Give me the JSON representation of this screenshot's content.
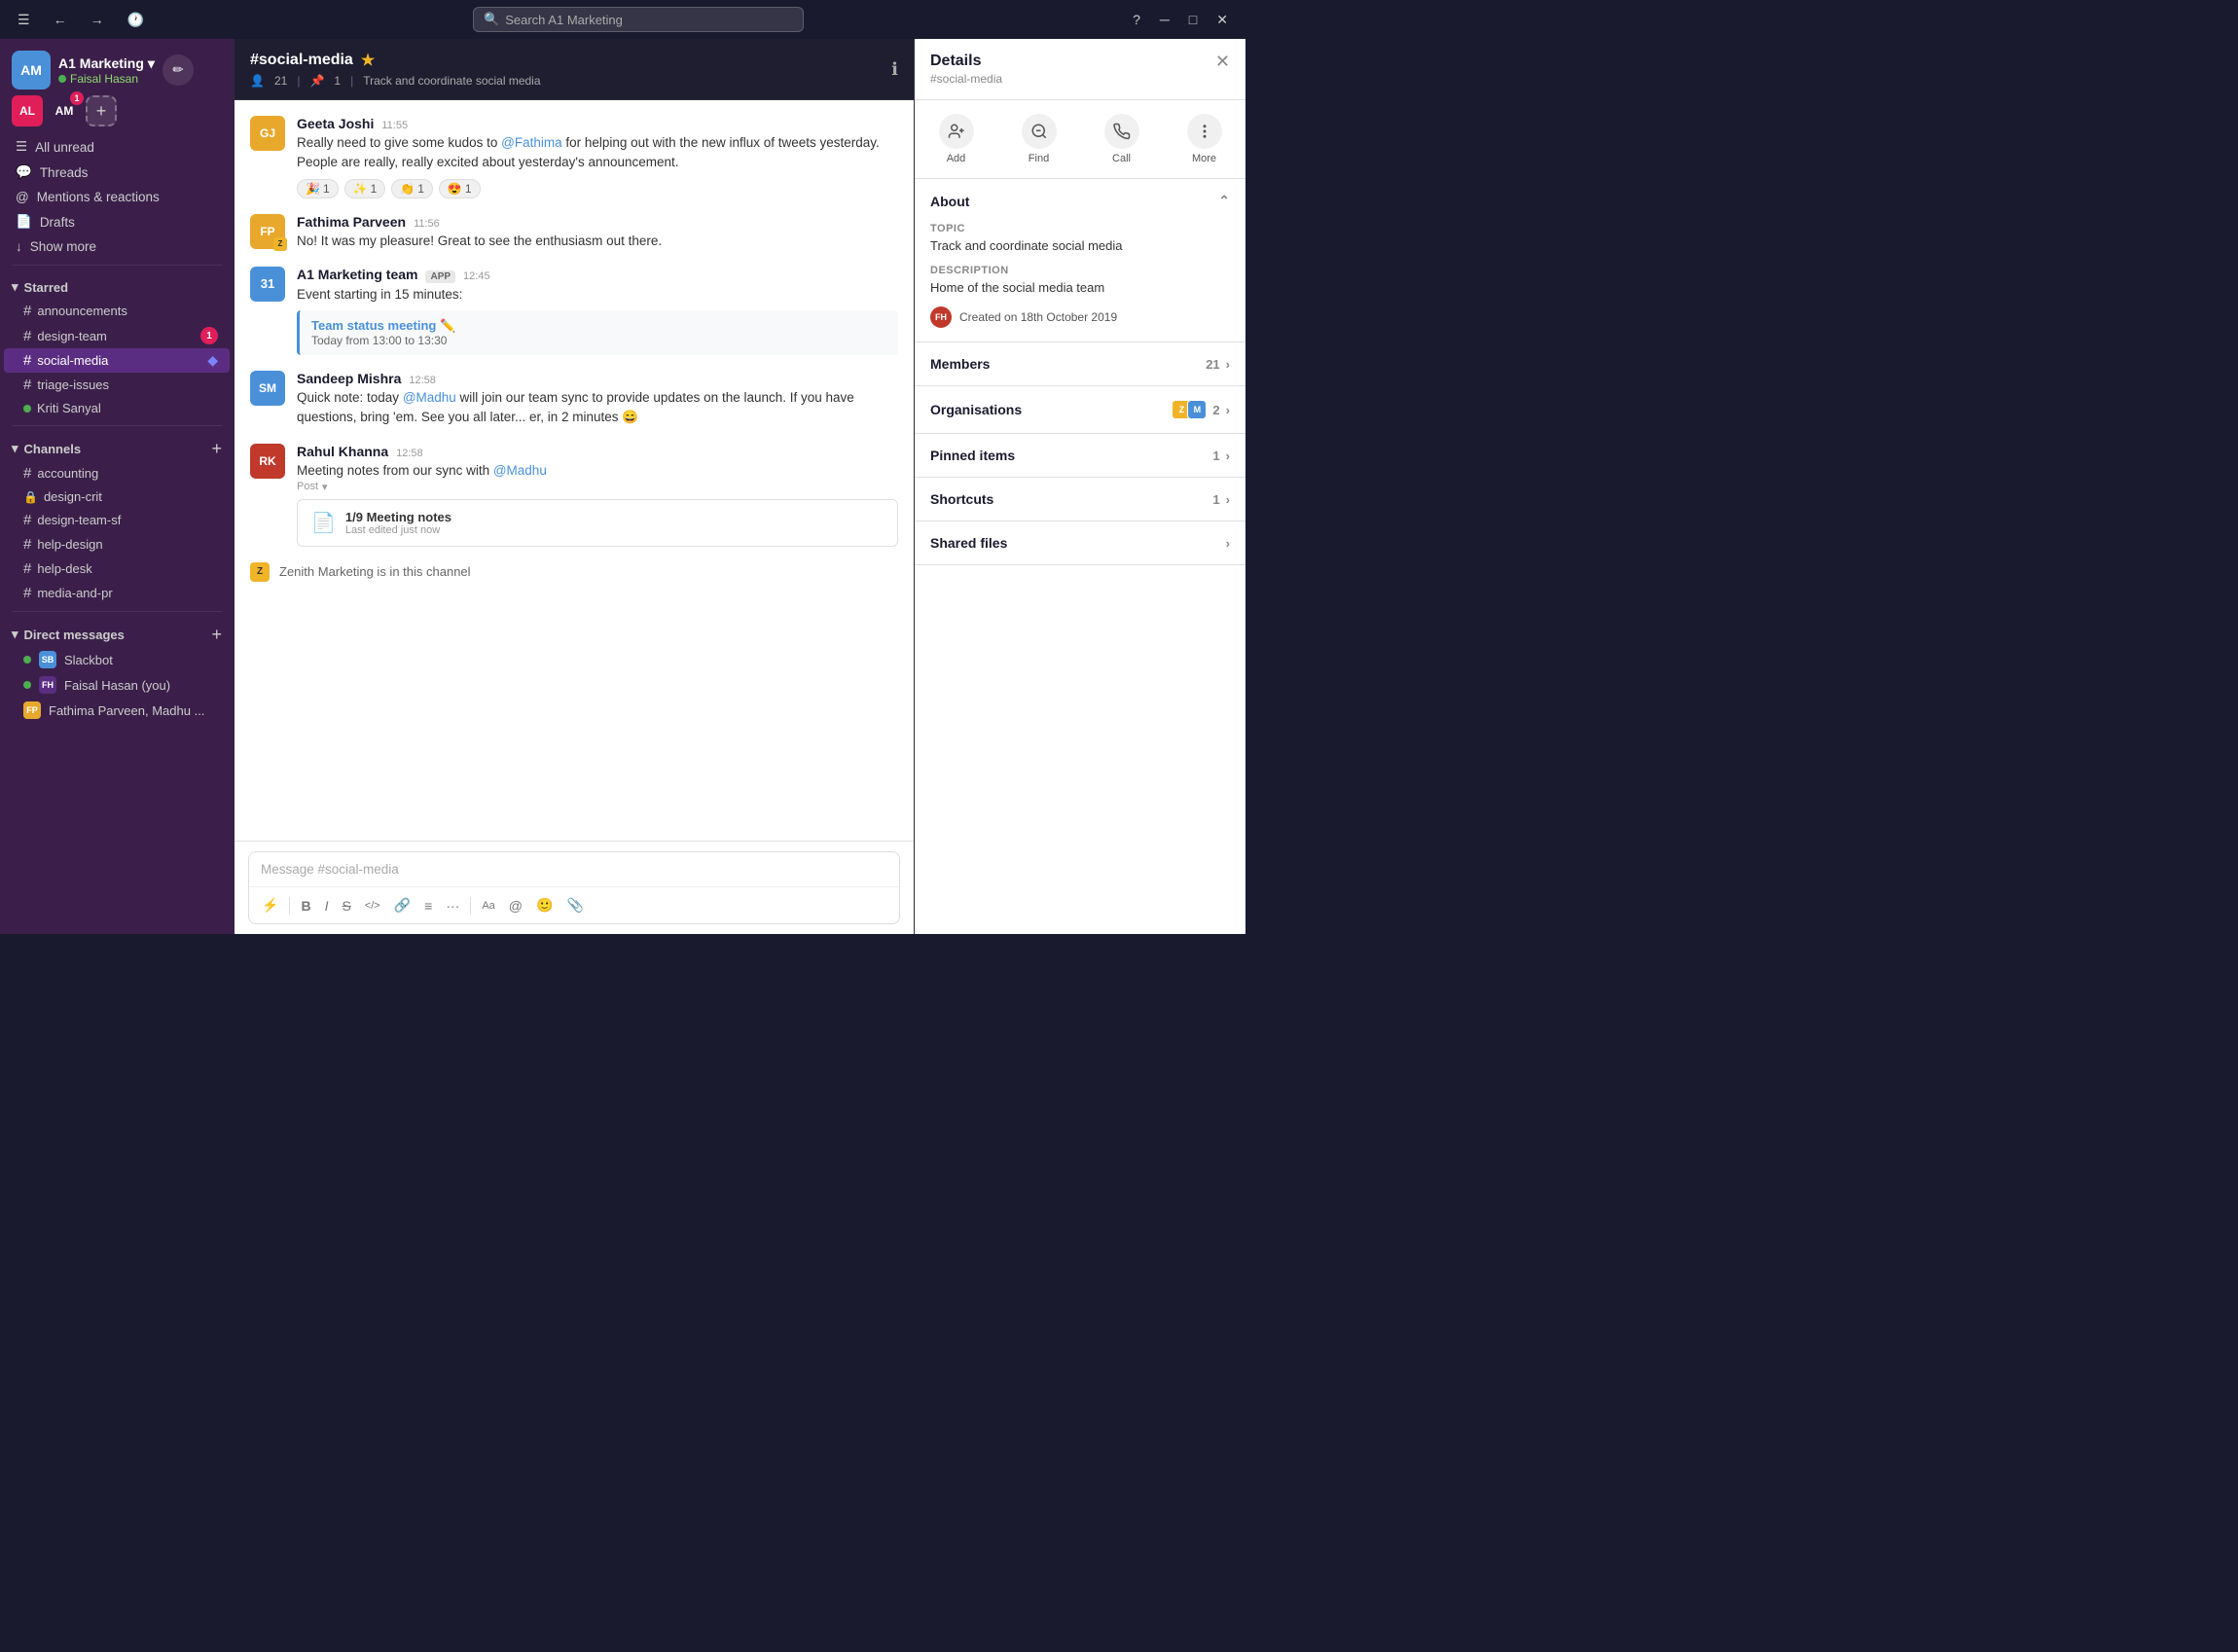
{
  "titleBar": {
    "searchPlaceholder": "Search A1 Marketing"
  },
  "workspace": {
    "name": "A1 Marketing",
    "initials": "AM",
    "user": "Faisal Hasan",
    "avatarColor": "#4a90d9"
  },
  "sidebarAlt": {
    "initials": "AL",
    "color": "#e01e5a"
  },
  "sidebarNav": [
    {
      "key": "all-unread",
      "label": "All unread",
      "icon": "≡"
    },
    {
      "key": "threads",
      "label": "Threads",
      "icon": "⊕"
    },
    {
      "key": "mentions",
      "label": "Mentions & reactions",
      "icon": "⊕"
    },
    {
      "key": "drafts",
      "label": "Drafts",
      "icon": "⊕"
    },
    {
      "key": "show-more",
      "label": "Show more",
      "icon": "↓"
    }
  ],
  "starred": {
    "label": "Starred",
    "items": [
      {
        "key": "announcements",
        "name": "announcements",
        "type": "hash"
      },
      {
        "key": "design-team",
        "name": "design-team",
        "type": "hash",
        "badge": 1
      },
      {
        "key": "social-media",
        "name": "social-media",
        "type": "hash",
        "active": true
      },
      {
        "key": "triage-issues",
        "name": "triage-issues",
        "type": "hash"
      },
      {
        "key": "kriti-sanyal",
        "name": "Kriti Sanyal",
        "type": "dm",
        "online": true
      }
    ]
  },
  "channels": {
    "label": "Channels",
    "items": [
      {
        "key": "accounting",
        "name": "accounting",
        "type": "hash"
      },
      {
        "key": "design-crit",
        "name": "design-crit",
        "type": "lock"
      },
      {
        "key": "design-team-sf",
        "name": "design-team-sf",
        "type": "hash"
      },
      {
        "key": "help-design",
        "name": "help-design",
        "type": "hash"
      },
      {
        "key": "help-desk",
        "name": "help-desk",
        "type": "hash"
      },
      {
        "key": "media-and-pr",
        "name": "media-and-pr",
        "type": "hash"
      }
    ]
  },
  "directMessages": {
    "label": "Direct messages",
    "items": [
      {
        "key": "slackbot",
        "name": "Slackbot",
        "online": true,
        "color": "#4a90d9",
        "initials": "SB"
      },
      {
        "key": "faisal-you",
        "name": "Faisal Hasan (you)",
        "online": true,
        "color": "#5b2d82",
        "initials": "FH"
      },
      {
        "key": "fathima-madhu",
        "name": "Fathima Parveen, Madhu ...",
        "online": false,
        "color": "#e8a82c",
        "initials": "FP"
      }
    ]
  },
  "chat": {
    "channelName": "#social-media",
    "channelStar": "★",
    "memberCount": "21",
    "pinnedCount": "1",
    "description": "Track and coordinate social media",
    "messages": [
      {
        "id": "msg1",
        "author": "Geeta Joshi",
        "time": "11:55",
        "avatarColor": "#e8a82c",
        "avatarInitials": "GJ",
        "text": "Really need to give some kudos to @Fathima for helping out with the new influx of tweets yesterday. People are really, really excited about yesterday's announcement.",
        "mention": "@Fathima",
        "reactions": [
          {
            "emoji": "🎉",
            "count": 1
          },
          {
            "emoji": "✨",
            "count": 1
          },
          {
            "emoji": "👏",
            "count": 1
          },
          {
            "emoji": "😍",
            "count": 1
          }
        ]
      },
      {
        "id": "msg2",
        "author": "Fathima Parveen",
        "time": "11:56",
        "avatarColor": "#e8a82c",
        "avatarInitials": "FP",
        "hasZBadge": true,
        "text": "No! It was my pleasure! Great to see the enthusiasm out there."
      },
      {
        "id": "msg3",
        "author": "A1 Marketing team",
        "time": "12:45",
        "avatarColor": "#4a90d9",
        "avatarInitials": "31",
        "isApp": true,
        "appBadge": "APP",
        "text": "Event starting in 15 minutes:",
        "event": {
          "title": "Team status meeting ✏️",
          "time": "Today from 13:00 to 13:30"
        }
      },
      {
        "id": "msg4",
        "author": "Sandeep Mishra",
        "time": "12:58",
        "avatarColor": "#4a90d9",
        "avatarInitials": "SM",
        "text": "Quick note: today @Madhu will join our team sync to provide updates on the launch. If you have questions, bring 'em. See you all later... er, in 2 minutes 😄",
        "mention": "@Madhu"
      },
      {
        "id": "msg5",
        "author": "Rahul Khanna",
        "time": "12:58",
        "avatarColor": "#c0392b",
        "avatarInitials": "RK",
        "text": "Meeting notes from our sync with @Madhu",
        "mention": "@Madhu",
        "hasPost": true,
        "postTitle": "1/9 Meeting notes",
        "postSubtitle": "Last edited just now",
        "postLabel": "Post"
      }
    ],
    "zenithNotice": "Zenith Marketing is in this channel",
    "inputPlaceholder": "Message #social-media",
    "toolbar": [
      {
        "key": "lightning",
        "label": "⚡",
        "title": "Shortcuts"
      },
      {
        "key": "bold",
        "label": "B",
        "title": "Bold"
      },
      {
        "key": "italic",
        "label": "I",
        "title": "Italic"
      },
      {
        "key": "strike",
        "label": "S̶",
        "title": "Strikethrough"
      },
      {
        "key": "code",
        "label": "</>",
        "title": "Code"
      },
      {
        "key": "link",
        "label": "🔗",
        "title": "Link"
      },
      {
        "key": "list",
        "label": "≡",
        "title": "List"
      },
      {
        "key": "more",
        "label": "···",
        "title": "More"
      },
      {
        "key": "text-size",
        "label": "Aa",
        "title": "Text size"
      },
      {
        "key": "mention",
        "label": "@",
        "title": "Mention"
      },
      {
        "key": "emoji",
        "label": "🙂",
        "title": "Emoji"
      },
      {
        "key": "attach",
        "label": "📎",
        "title": "Attach"
      }
    ]
  },
  "details": {
    "title": "Details",
    "subtitle": "#social-media",
    "actions": [
      {
        "key": "add",
        "label": "Add",
        "icon": "👤+"
      },
      {
        "key": "find",
        "label": "Find",
        "icon": "🔍"
      },
      {
        "key": "call",
        "label": "Call",
        "icon": "📞"
      },
      {
        "key": "more",
        "label": "More",
        "icon": "···"
      }
    ],
    "about": {
      "label": "About",
      "topic": {
        "label": "Topic",
        "value": "Track and coordinate social media"
      },
      "description": {
        "label": "Description",
        "value": "Home of the social media team"
      },
      "created": "Created on 18th October 2019",
      "creatorInitials": "FH",
      "creatorColor": "#5b2d82"
    },
    "members": {
      "label": "Members",
      "count": "21"
    },
    "organisations": {
      "label": "Organisations",
      "count": "2",
      "org1Color": "#f0b429",
      "org1Initial": "Z",
      "org2Color": "#4a90d9",
      "org2Initial": "M"
    },
    "pinnedItems": {
      "label": "Pinned items",
      "count": "1"
    },
    "shortcuts": {
      "label": "Shortcuts",
      "count": "1"
    },
    "sharedFiles": {
      "label": "Shared files"
    }
  }
}
